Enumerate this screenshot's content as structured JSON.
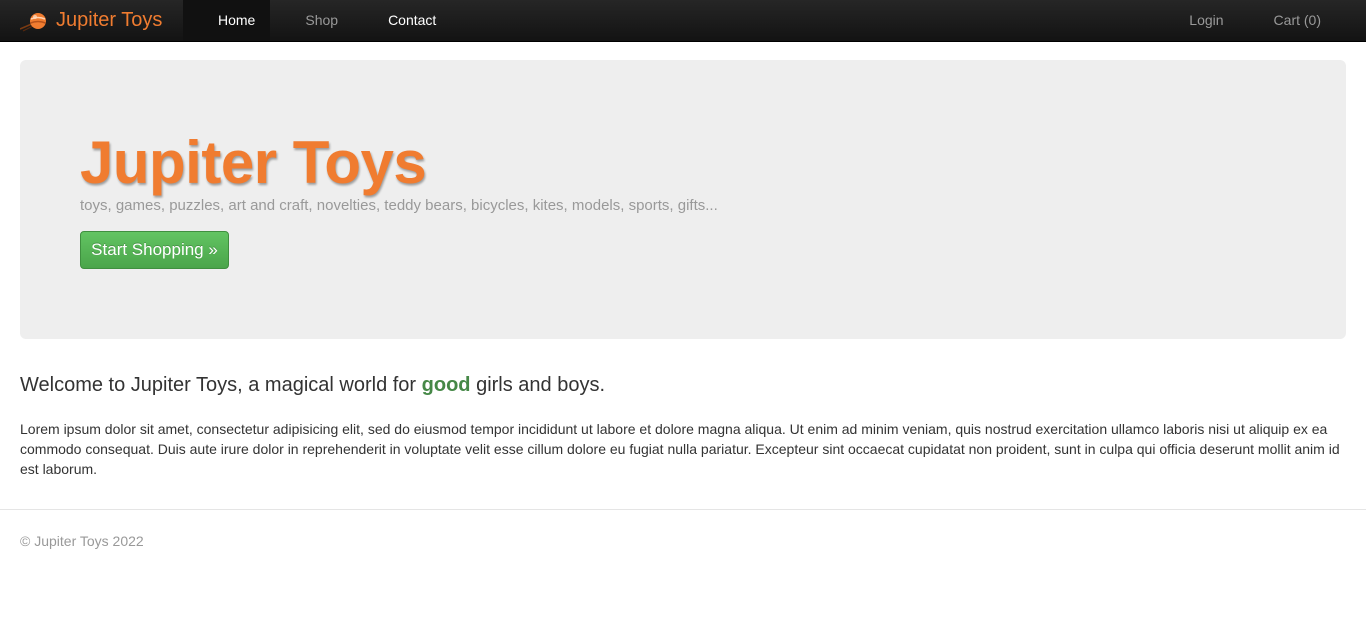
{
  "navbar": {
    "brand": "Jupiter Toys",
    "left_items": [
      {
        "label": "Home",
        "active": true
      },
      {
        "label": "Shop",
        "active": false
      },
      {
        "label": "Contact",
        "active": false
      }
    ],
    "right_items": [
      {
        "label": "Login"
      },
      {
        "label": "Cart (0)"
      }
    ]
  },
  "hero": {
    "title": "Jupiter Toys",
    "subtitle": "toys, games, puzzles, art and craft, novelties, teddy bears, bicycles, kites, models, sports, gifts...",
    "button_label": "Start Shopping »"
  },
  "welcome": {
    "before": "Welcome to Jupiter Toys, a magical world for ",
    "emphasis": "good",
    "after": " girls and boys."
  },
  "body_text": "Lorem ipsum dolor sit amet, consectetur adipisicing elit, sed do eiusmod tempor incididunt ut labore et dolore magna aliqua. Ut enim ad minim veniam, quis nostrud exercitation ullamco laboris nisi ut aliquip ex ea commodo consequat. Duis aute irure dolor in reprehenderit in voluptate velit esse cillum dolore eu fugiat nulla pariatur. Excepteur sint occaecat cupidatat non proident, sunt in culpa qui officia deserunt mollit anim id est laborum.",
  "footer": {
    "copyright": "© Jupiter Toys 2022"
  },
  "colors": {
    "brand_orange": "#f07c30",
    "button_green": "#5bb75b",
    "good_green": "#468847",
    "hero_bg": "#eeeeee",
    "navbar_bg": "#1b1b1b"
  },
  "icons": {
    "brand_logo": "planet-logo-icon"
  }
}
